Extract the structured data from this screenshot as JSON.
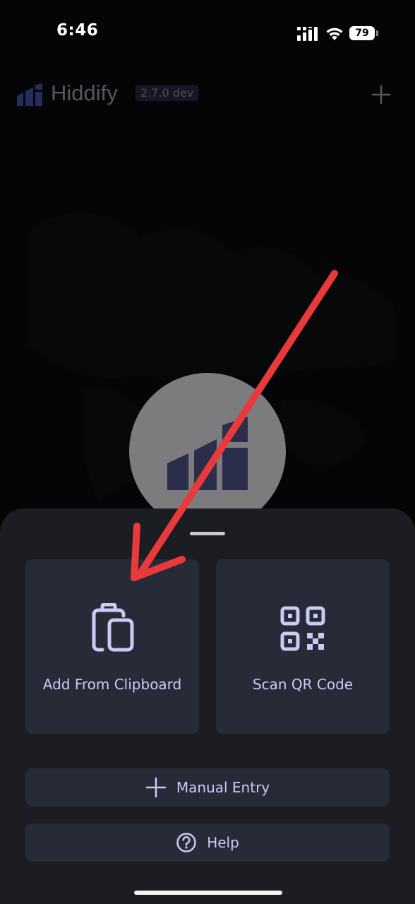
{
  "status_bar": {
    "time": "6:46",
    "battery": "79"
  },
  "header": {
    "title": "Hiddify",
    "version": "2.7.0 dev",
    "add_icon": "plus-icon",
    "logo_icon": "hiddify-logo-icon"
  },
  "sheet": {
    "tiles": [
      {
        "label": "Add From Clipboard",
        "icon": "clipboard-icon"
      },
      {
        "label": "Scan QR Code",
        "icon": "qr-code-icon"
      }
    ],
    "buttons": [
      {
        "label": "Manual Entry",
        "icon": "plus-icon"
      },
      {
        "label": "Help",
        "icon": "help-circle-icon"
      }
    ]
  },
  "colors": {
    "accent": "#c9cbf4",
    "tile_bg": "#272a37",
    "sheet_bg": "#1c1d23",
    "annotation_arrow": "#e8393b"
  }
}
